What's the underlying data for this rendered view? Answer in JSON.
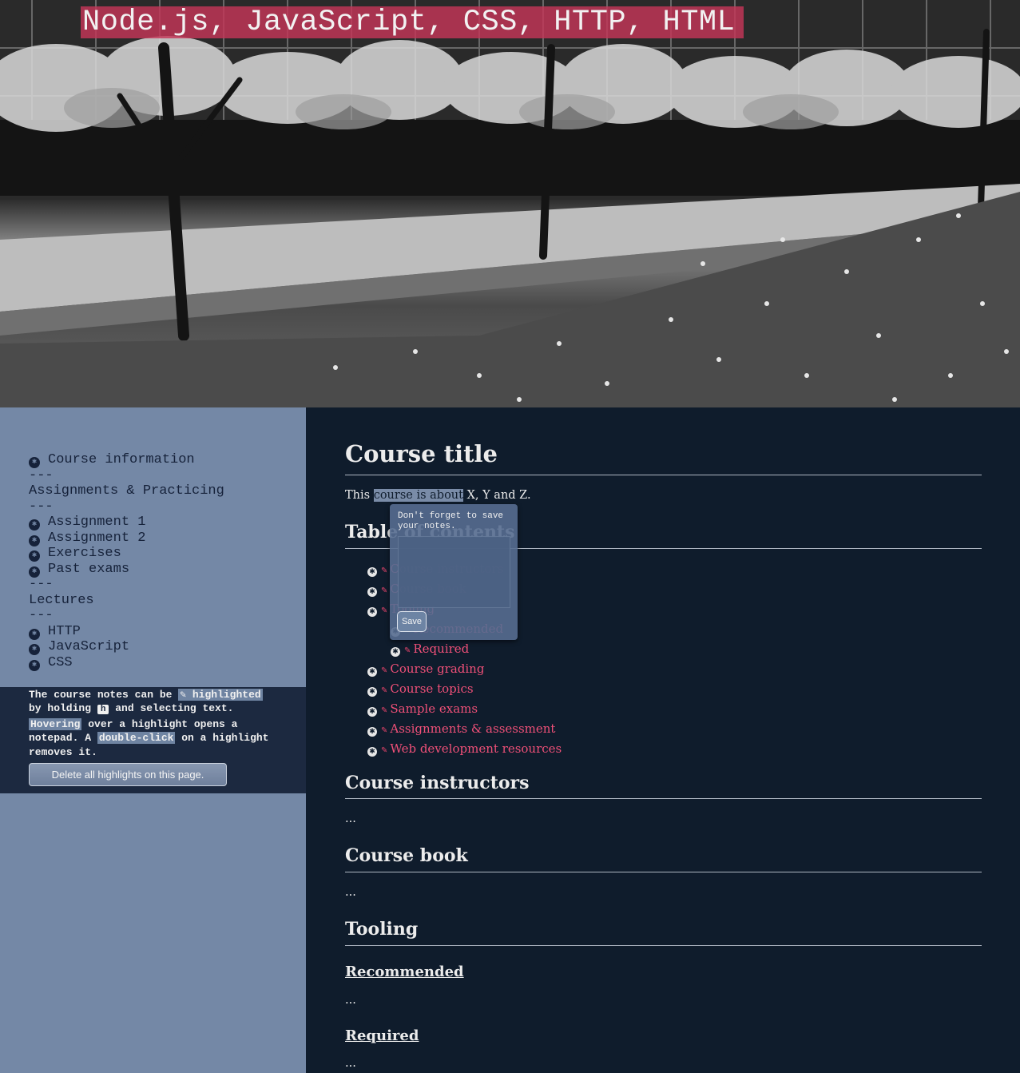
{
  "header": {
    "title": "Node.js, JavaScript, CSS, HTTP, HTML"
  },
  "sidebar": {
    "items": [
      {
        "type": "link",
        "label": "Course information"
      },
      {
        "type": "sep",
        "label": "---"
      },
      {
        "type": "heading",
        "label": "Assignments & Practicing"
      },
      {
        "type": "sep",
        "label": "---"
      },
      {
        "type": "link",
        "label": "Assignment 1"
      },
      {
        "type": "link",
        "label": "Assignment 2"
      },
      {
        "type": "link",
        "label": "Exercises"
      },
      {
        "type": "link",
        "label": "Past exams"
      },
      {
        "type": "sep",
        "label": "---"
      },
      {
        "type": "heading",
        "label": "Lectures"
      },
      {
        "type": "sep",
        "label": "---"
      },
      {
        "type": "link",
        "label": "HTTP"
      },
      {
        "type": "link",
        "label": "JavaScript"
      },
      {
        "type": "link",
        "label": "CSS"
      }
    ],
    "help": {
      "t1": "The course notes can be ",
      "highlighted": "✎ highlighted",
      "t2": "by holding ",
      "key": "h",
      "t3": " and selecting text.",
      "hovering": "Hovering",
      "t4": " over a highlight opens a notepad. A ",
      "dblclick": "double-click",
      "t5": " on a highlight removes it."
    },
    "delete_button": "Delete all highlights on this page."
  },
  "main": {
    "course_title": "Course title",
    "intro_before": "This ",
    "intro_highlight": "course is about",
    "intro_after": " X, Y and Z.",
    "toc_heading": "Table of contents",
    "toc": [
      {
        "label": "Course instructors",
        "level": 0
      },
      {
        "label": "Course book",
        "level": 0
      },
      {
        "label": "Tooling",
        "level": 0
      },
      {
        "label": "Recommended",
        "level": 1
      },
      {
        "label": "Required",
        "level": 1
      },
      {
        "label": "Course grading",
        "level": 0
      },
      {
        "label": "Course topics",
        "level": 0
      },
      {
        "label": "Sample exams",
        "level": 0
      },
      {
        "label": "Assignments & assessment",
        "level": 0
      },
      {
        "label": "Web development resources",
        "level": 0
      }
    ],
    "sections": {
      "instructors": "Course instructors",
      "instructors_body": "...",
      "book": "Course book",
      "book_body": "...",
      "tooling": "Tooling",
      "recommended": "Recommended",
      "recommended_body": "...",
      "required": "Required",
      "required_body": "..."
    }
  },
  "notepad": {
    "message": "Don't forget to save your notes.",
    "save_label": "Save"
  },
  "colors": {
    "accent": "#f05078",
    "sidebar_bg": "#7488a6",
    "main_bg": "#0f1c2c",
    "title_bg": "#c43658"
  }
}
